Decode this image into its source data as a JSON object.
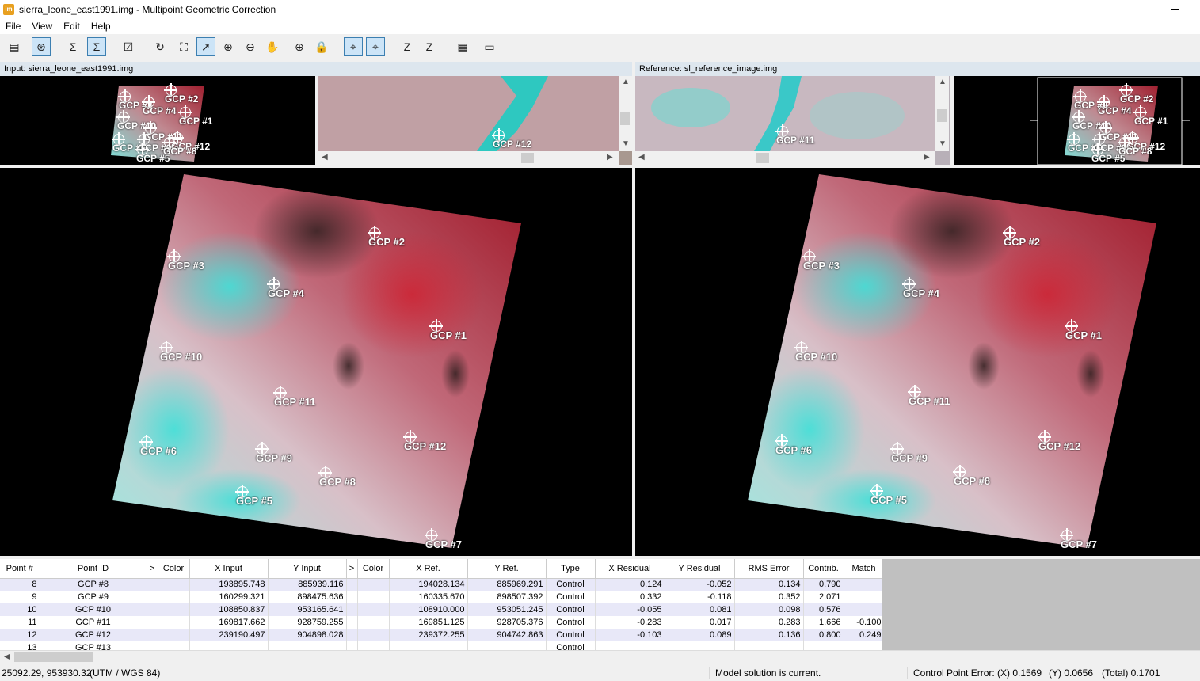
{
  "window": {
    "title": "sierra_leone_east1991.img - Multipoint Geometric Correction",
    "icon_text": "im"
  },
  "menu": [
    "File",
    "View",
    "Edit",
    "Help"
  ],
  "toolbar": {
    "icons": [
      {
        "name": "table-icon",
        "glyph": "▤",
        "active": false
      },
      {
        "name": "model-properties-icon",
        "glyph": "⊛",
        "active": true
      },
      {
        "name": "sigma-icon",
        "glyph": "Σ",
        "active": false
      },
      {
        "name": "auto-calc-icon",
        "glyph": "Σ",
        "active": true
      },
      {
        "name": "check-icon",
        "glyph": "☑",
        "active": false
      },
      {
        "name": "refresh-icon",
        "glyph": "↻",
        "active": false
      },
      {
        "name": "fit-icon",
        "glyph": "⛶",
        "active": false
      },
      {
        "name": "select-arrow-icon",
        "glyph": "➚",
        "active": true
      },
      {
        "name": "zoom-in-icon",
        "glyph": "⊕",
        "active": false
      },
      {
        "name": "zoom-out-icon",
        "glyph": "⊖",
        "active": false
      },
      {
        "name": "pan-hand-icon",
        "glyph": "✋",
        "active": false
      },
      {
        "name": "create-gcp-icon",
        "glyph": "⊕",
        "active": false
      },
      {
        "name": "lock-icon",
        "glyph": "🔒",
        "active": false
      },
      {
        "name": "find-point-icon",
        "glyph": "⌖",
        "active": true
      },
      {
        "name": "find-point-add-icon",
        "glyph": "⌖",
        "active": true
      },
      {
        "name": "z-icon",
        "glyph": "Z",
        "active": false
      },
      {
        "name": "z-compute-icon",
        "glyph": "Z",
        "active": false
      },
      {
        "name": "grid-icon",
        "glyph": "▦",
        "active": false
      },
      {
        "name": "ruler-icon",
        "glyph": "▭",
        "active": false
      }
    ]
  },
  "input_panel": {
    "label": "Input: sierra_leone_east1991.img"
  },
  "reference_panel": {
    "label": "Reference: sl_reference_image.img"
  },
  "input_zoom_gcp": "GCP #12",
  "reference_zoom_gcp": "GCP #11",
  "gcps": [
    "GCP #1",
    "GCP #2",
    "GCP #3",
    "GCP #4",
    "GCP #5",
    "GCP #6",
    "GCP #7",
    "GCP #8",
    "GCP #9",
    "GCP #10",
    "GCP #11",
    "GCP #12"
  ],
  "overview_gcps": [
    "GCP #2",
    "GCP #3",
    "GCP #4",
    "GCP #1",
    "GCP #10",
    "GCP #11",
    "GCP #12",
    "GCP #6",
    "GCP #9",
    "GCP #5",
    "GCP #8"
  ],
  "table": {
    "headers": [
      "Point #",
      "Point ID",
      ">",
      "Color",
      "X Input",
      "Y Input",
      ">",
      "Color",
      "X Ref.",
      "Y Ref.",
      "Type",
      "X Residual",
      "Y Residual",
      "RMS Error",
      "Contrib.",
      "Match"
    ],
    "rows": [
      [
        "8",
        "GCP #8",
        "",
        "",
        "193895.748",
        "885939.116",
        "",
        "",
        "194028.134",
        "885969.291",
        "Control",
        "0.124",
        "-0.052",
        "0.134",
        "0.790",
        ""
      ],
      [
        "9",
        "GCP #9",
        "",
        "",
        "160299.321",
        "898475.636",
        "",
        "",
        "160335.670",
        "898507.392",
        "Control",
        "0.332",
        "-0.118",
        "0.352",
        "2.071",
        ""
      ],
      [
        "10",
        "GCP #10",
        "",
        "",
        "108850.837",
        "953165.641",
        "",
        "",
        "108910.000",
        "953051.245",
        "Control",
        "-0.055",
        "0.081",
        "0.098",
        "0.576",
        ""
      ],
      [
        "11",
        "GCP #11",
        "",
        "",
        "169817.662",
        "928759.255",
        "",
        "",
        "169851.125",
        "928705.376",
        "Control",
        "-0.283",
        "0.017",
        "0.283",
        "1.666",
        "-0.100"
      ],
      [
        "12",
        "GCP #12",
        "",
        "",
        "239190.497",
        "904898.028",
        "",
        "",
        "239372.255",
        "904742.863",
        "Control",
        "-0.103",
        "0.089",
        "0.136",
        "0.800",
        "0.249"
      ],
      [
        "13",
        "GCP #13",
        "",
        "",
        "",
        "",
        "",
        "",
        "",
        "",
        "Control",
        "",
        "",
        "",
        "",
        ""
      ]
    ]
  },
  "status": {
    "coords": "25092.29, 953930.32",
    "projection": "(UTM / WGS 84)",
    "model": "Model solution is current.",
    "error_label": "Control Point Error: (X) 0.1569",
    "error_y": "(Y) 0.0656",
    "error_total": "(Total) 0.1701"
  }
}
